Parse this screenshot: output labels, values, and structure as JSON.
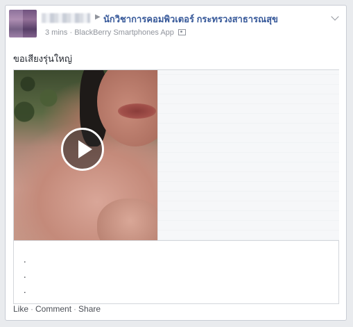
{
  "post": {
    "target_name": "นักวิชาการคอมพิวเตอร์ กระทรวงสาธารณสุข",
    "meta": {
      "time": "3 mins",
      "separator": "·",
      "app": "BlackBerry Smartphones App"
    },
    "message": "ขอเสียงรุ่นใหญ่",
    "caption_lines": [
      ".",
      ".",
      "."
    ],
    "actions": {
      "like": "Like",
      "comment": "Comment",
      "share": "Share",
      "separator": "·"
    }
  },
  "icons": {
    "arrow": "right-arrow-icon",
    "audience": "audience-icon",
    "chevron": "chevron-down-icon",
    "play": "play-icon"
  },
  "colors": {
    "link_blue": "#365899",
    "meta_gray": "#90949c",
    "text": "#1d2129",
    "border": "#c8ccd4"
  }
}
